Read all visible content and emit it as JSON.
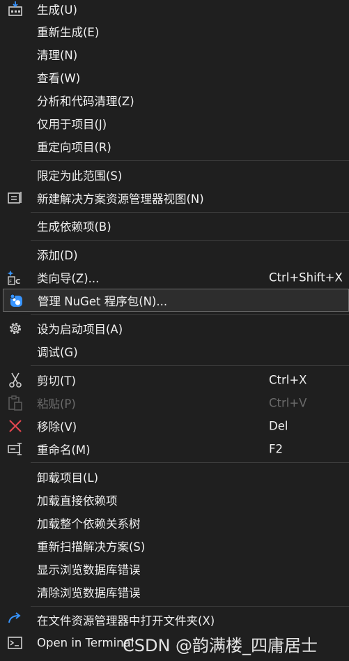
{
  "menu": {
    "items": [
      {
        "label": "生成(U)",
        "shortcut": "",
        "icon": "build-icon"
      },
      {
        "label": "重新生成(E)",
        "shortcut": ""
      },
      {
        "label": "清理(N)",
        "shortcut": ""
      },
      {
        "label": "查看(W)",
        "shortcut": ""
      },
      {
        "label": "分析和代码清理(Z)",
        "shortcut": ""
      },
      {
        "label": "仅用于项目(J)",
        "shortcut": ""
      },
      {
        "label": "重定向项目(R)",
        "shortcut": ""
      },
      {
        "label": "限定为此范围(S)",
        "shortcut": ""
      },
      {
        "label": "新建解决方案资源管理器视图(N)",
        "shortcut": "",
        "icon": "new-view-icon"
      },
      {
        "label": "生成依赖项(B)",
        "shortcut": ""
      },
      {
        "label": "添加(D)",
        "shortcut": ""
      },
      {
        "label": "类向导(Z)...",
        "shortcut": "Ctrl+Shift+X",
        "icon": "class-wizard-icon"
      },
      {
        "label": "管理 NuGet 程序包(N)...",
        "shortcut": "",
        "icon": "nuget-icon",
        "highlighted": true
      },
      {
        "label": "设为启动项目(A)",
        "shortcut": "",
        "icon": "gear-icon"
      },
      {
        "label": "调试(G)",
        "shortcut": ""
      },
      {
        "label": "剪切(T)",
        "shortcut": "Ctrl+X",
        "icon": "scissors-icon"
      },
      {
        "label": "粘贴(P)",
        "shortcut": "Ctrl+V",
        "icon": "paste-icon",
        "disabled": true
      },
      {
        "label": "移除(V)",
        "shortcut": "Del",
        "icon": "remove-x-icon"
      },
      {
        "label": "重命名(M)",
        "shortcut": "F2",
        "icon": "rename-icon"
      },
      {
        "label": "卸载项目(L)",
        "shortcut": ""
      },
      {
        "label": "加载直接依赖项",
        "shortcut": ""
      },
      {
        "label": "加载整个依赖关系树",
        "shortcut": ""
      },
      {
        "label": "重新扫描解决方案(S)",
        "shortcut": ""
      },
      {
        "label": "显示浏览数据库错误",
        "shortcut": ""
      },
      {
        "label": "清除浏览数据库错误",
        "shortcut": ""
      },
      {
        "label": "在文件资源管理器中打开文件夹(X)",
        "shortcut": "",
        "icon": "open-folder-arrow-icon"
      },
      {
        "label": "Open in Terminal",
        "shortcut": "",
        "icon": "terminal-icon"
      }
    ]
  },
  "watermark": "CSDN @韵满楼_四庸居士",
  "colors": {
    "background": "#1f1f1f",
    "text": "#f0f0f0",
    "disabled_text": "#6b6b6b",
    "highlight_border": "#6e6e6e",
    "remove_red": "#e0464e",
    "accent_blue": "#3794ff"
  }
}
